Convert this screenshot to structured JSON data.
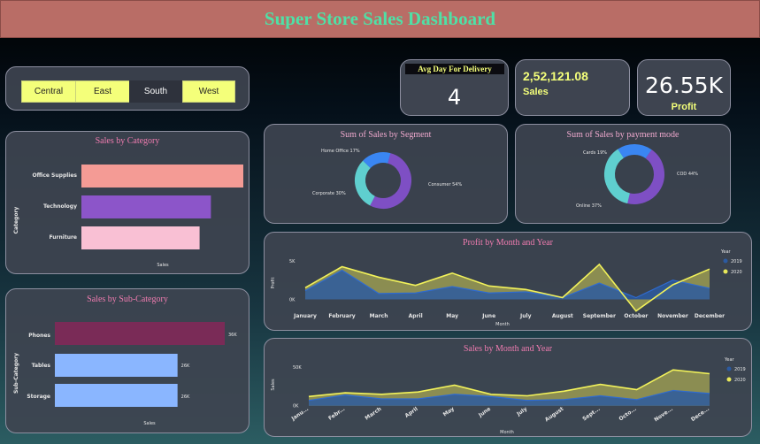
{
  "header": {
    "title": "Super Store Sales Dashboard"
  },
  "region_slicer": {
    "options": [
      "Central",
      "East",
      "South",
      "West"
    ],
    "selected": "South"
  },
  "kpis": {
    "delivery": {
      "label": "Avg Day For Delivery",
      "value": "4"
    },
    "sales": {
      "value": "2,52,121.08",
      "label": "Sales"
    },
    "profit": {
      "value": "26.55K",
      "label": "Profit"
    }
  },
  "sales_by_category": {
    "title": "Sales by Category",
    "y_axis_label": "Category",
    "x_axis_label": "Sales",
    "bars": [
      {
        "label": "Office Supplies",
        "color": "#f49b95"
      },
      {
        "label": "Technology",
        "color": "#8c55c9"
      },
      {
        "label": "Furniture",
        "color": "#f9c0d4"
      }
    ]
  },
  "sales_by_subcategory": {
    "title": "Sales by Sub-Category",
    "y_axis_label": "Sub-Category",
    "x_axis_label": "Sales",
    "bars": [
      {
        "label": "Phones",
        "value_label": "36K",
        "color": "#7a2b57"
      },
      {
        "label": "Tables",
        "value_label": "26K",
        "color": "#8ab6ff"
      },
      {
        "label": "Storage",
        "value_label": "26K",
        "color": "#8ab6ff"
      }
    ]
  },
  "colors": {
    "accent_yellow": "#f4ff7a",
    "title_pink": "#f07cb0",
    "series_2019": "#2c5aa0",
    "series_2020": "#e8e85a"
  },
  "chart_data": [
    {
      "type": "bar",
      "title": "Sales by Category",
      "categories": [
        "Office Supplies",
        "Technology",
        "Furniture"
      ],
      "values": [
        1.0,
        0.8,
        0.73
      ],
      "xlabel": "Sales",
      "ylabel": "Category"
    },
    {
      "type": "bar",
      "title": "Sales by Sub-Category",
      "categories": [
        "Phones",
        "Tables",
        "Storage"
      ],
      "values": [
        36000,
        26000,
        26000
      ],
      "value_labels": [
        "36K",
        "26K",
        "26K"
      ],
      "xlabel": "Sales",
      "ylabel": "Sub-Category"
    },
    {
      "type": "pie",
      "title": "Sum of Sales by Segment",
      "categories": [
        "Consumer",
        "Corporate",
        "Home Office"
      ],
      "values": [
        54,
        30,
        17
      ],
      "labels": [
        "Consumer 54%",
        "Corporate 30%",
        "Home Office 17%"
      ],
      "colors": [
        "#7e4fc4",
        "#5fcfcf",
        "#3a86f2"
      ]
    },
    {
      "type": "pie",
      "title": "Sum of Sales by payment mode",
      "categories": [
        "COD",
        "Online",
        "Cards"
      ],
      "values": [
        44,
        37,
        19
      ],
      "labels": [
        "COD 44%",
        "Online 37%",
        "Cards 19%"
      ],
      "colors": [
        "#7e4fc4",
        "#5fcfcf",
        "#3a86f2"
      ]
    },
    {
      "type": "area",
      "title": "Profit by Month and Year",
      "xlabel": "Month",
      "ylabel": "Profit",
      "legend_title": "Year",
      "categories": [
        "January",
        "February",
        "March",
        "April",
        "May",
        "June",
        "July",
        "August",
        "September",
        "October",
        "November",
        "December"
      ],
      "ytick_labels": [
        "5K",
        "0K"
      ],
      "ylim": [
        -2500,
        7500
      ],
      "series": [
        {
          "name": "2019",
          "values": [
            1500,
            5000,
            1000,
            1100,
            2200,
            1100,
            1300,
            300,
            2800,
            300,
            3300,
            1900
          ]
        },
        {
          "name": "2020",
          "values": [
            2000,
            5600,
            3800,
            2400,
            4500,
            2300,
            1700,
            300,
            6000,
            -2000,
            2500,
            5200
          ]
        }
      ]
    },
    {
      "type": "area",
      "title": "Sales by Month and Year",
      "xlabel": "Month",
      "ylabel": "Sales",
      "legend_title": "Year",
      "categories": [
        "January",
        "February",
        "March",
        "April",
        "May",
        "June",
        "July",
        "August",
        "September",
        "October",
        "November",
        "December"
      ],
      "tick_labels": [
        "Janu...",
        "Febr...",
        "March",
        "April",
        "May",
        "June",
        "July",
        "August",
        "Sept...",
        "Octo...",
        "Nove...",
        "Dece..."
      ],
      "ytick_labels": [
        "50K",
        "0K"
      ],
      "ylim": [
        -5000,
        60000
      ],
      "series": [
        {
          "name": "2019",
          "values": [
            7000,
            14000,
            9000,
            9000,
            15000,
            12000,
            7000,
            8000,
            13000,
            8000,
            20000,
            16000
          ]
        },
        {
          "name": "2020",
          "values": [
            12000,
            17000,
            15000,
            18000,
            27000,
            15000,
            13000,
            19000,
            28000,
            21000,
            47000,
            42000
          ]
        }
      ]
    }
  ]
}
